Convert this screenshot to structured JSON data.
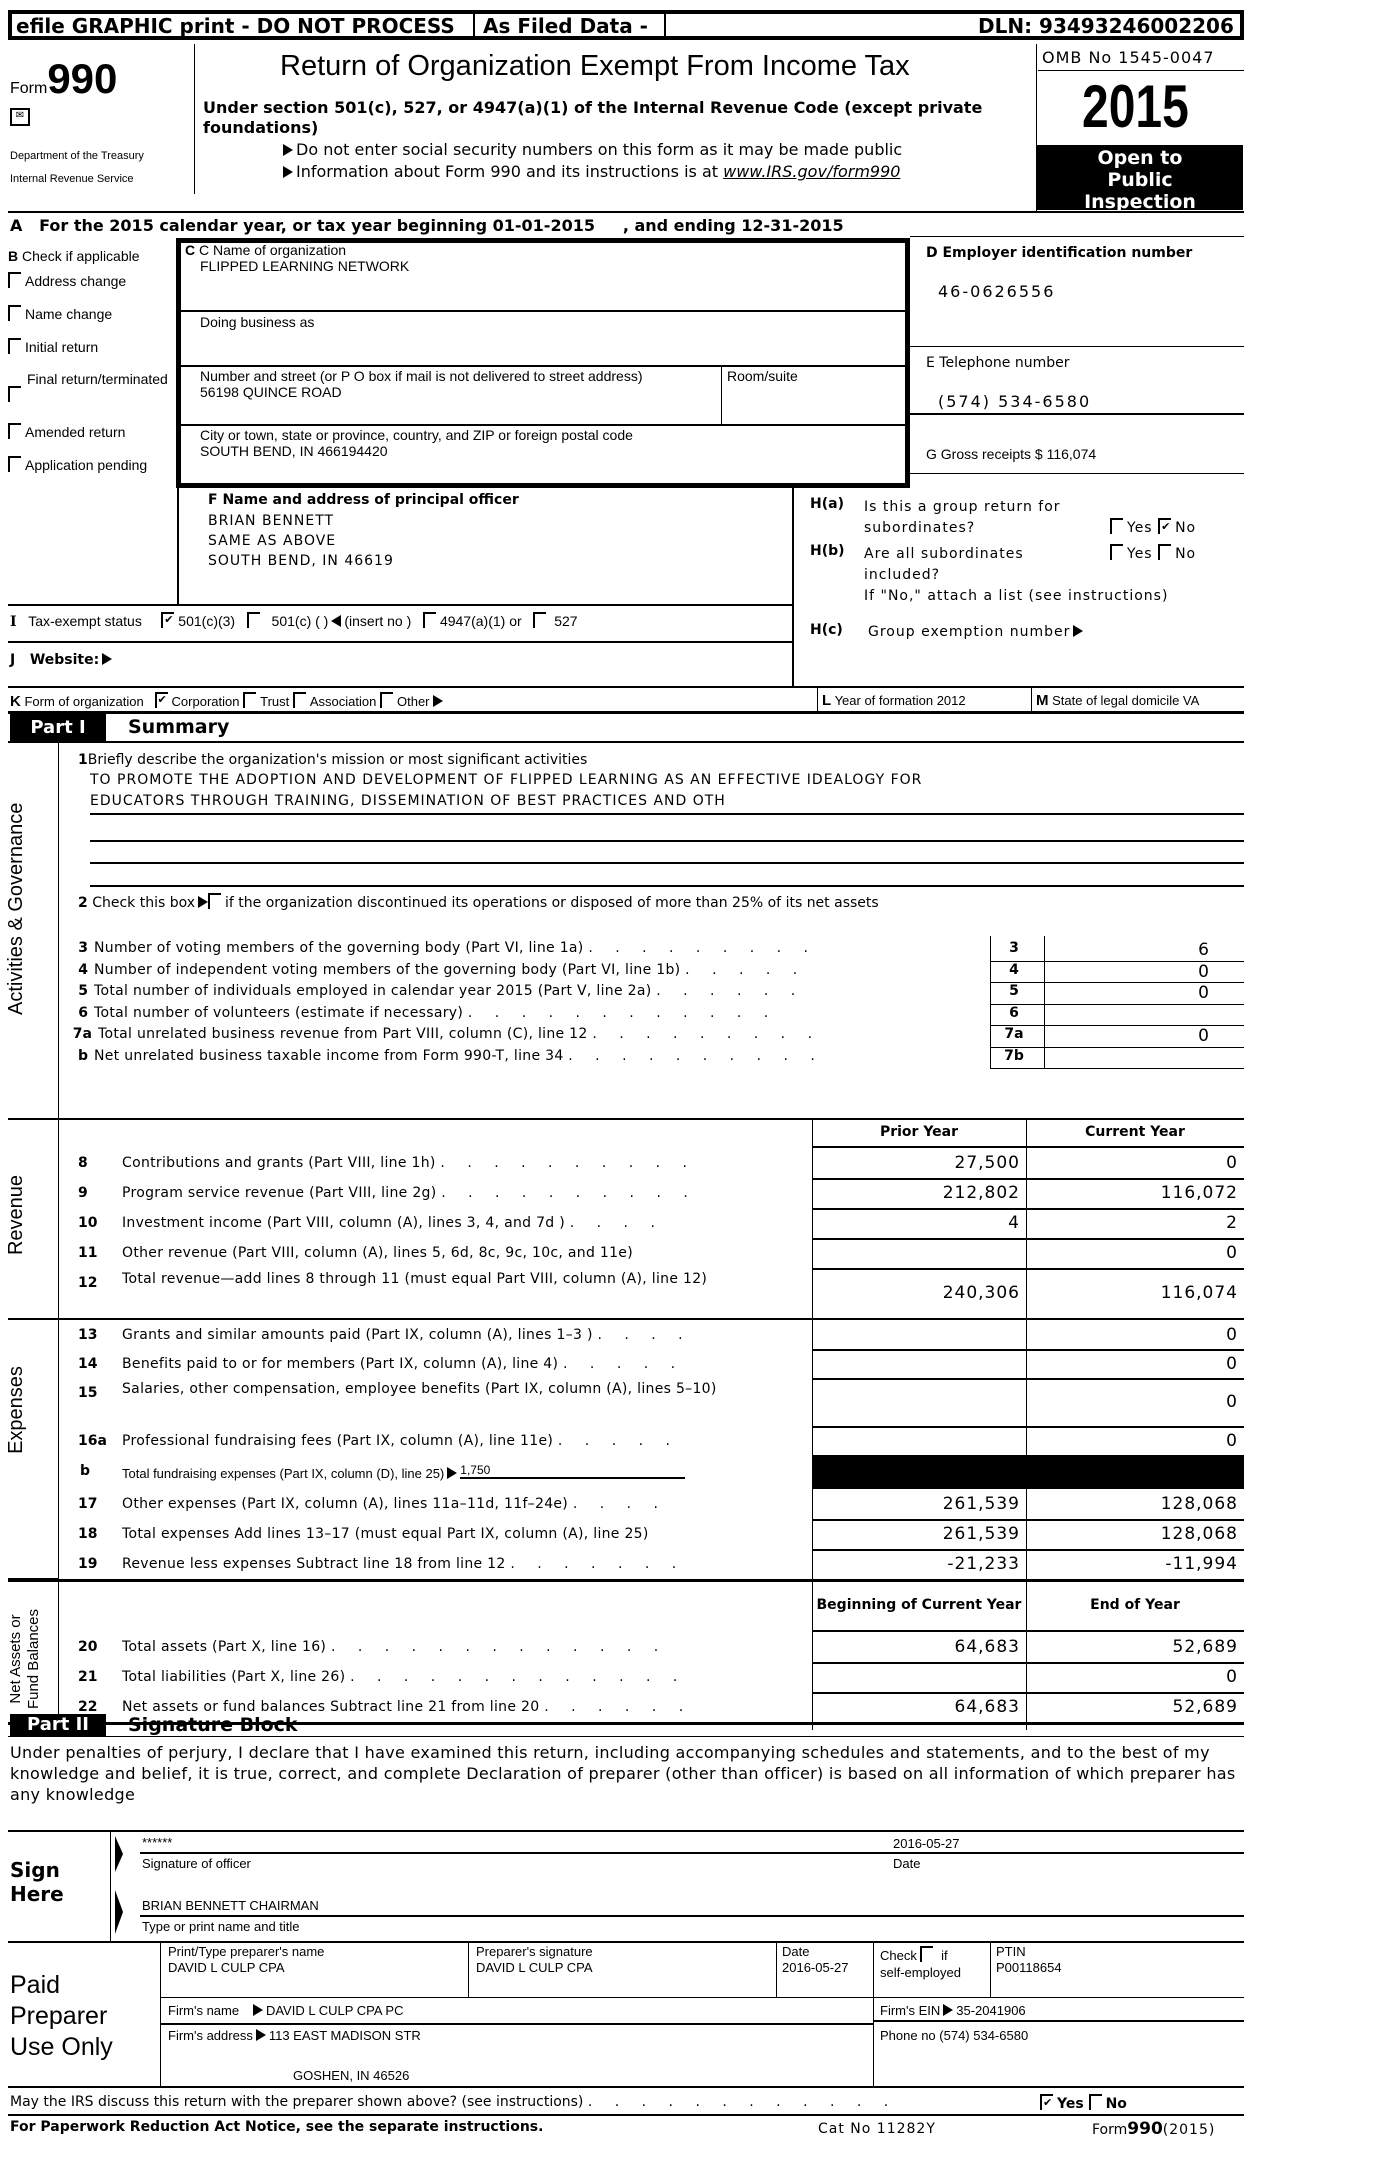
{
  "header": {
    "efile_label": "efile GRAPHIC print - DO NOT PROCESS",
    "as_filed": "As Filed Data -",
    "dln": "DLN: 93493246002206",
    "form_prefix": "Form",
    "form_number": "990",
    "dept1": "Department of the Treasury",
    "dept2": "Internal Revenue Service",
    "title": "Return of Organization Exempt From Income Tax",
    "subtitle": "Under section 501(c), 527, or 4947(a)(1) of the Internal Revenue Code (except private foundations)",
    "note1": "Do not enter social security numbers on this form as it may be made public",
    "note2_prefix": "Information about Form 990 and its instructions is at ",
    "note2_link": "www.IRS.gov/form990",
    "omb": "OMB No 1545-0047",
    "year": "2015",
    "open_public": "Open to Public Inspection"
  },
  "line_a": "A   For the 2015 calendar year, or tax year beginning 01-01-2015     , and ending 12-31-2015",
  "section_b": {
    "title": "B  Check if applicable",
    "items": [
      {
        "label": "Address change",
        "checked": false
      },
      {
        "label": "Name change",
        "checked": false
      },
      {
        "label": "Initial return",
        "checked": false
      },
      {
        "label": "Final return/terminated",
        "checked": false
      },
      {
        "label": "Amended return",
        "checked": false
      },
      {
        "label": "Application pending",
        "checked": false
      }
    ]
  },
  "section_c": {
    "name_label": "C Name of organization",
    "name_value": "FLIPPED LEARNING NETWORK",
    "dba_label": "Doing business as",
    "street_label": "Number and street (or P O  box if mail is not delivered to street address)",
    "street_value": "56198 QUINCE ROAD",
    "room_label": "Room/suite",
    "city_label": "City or town, state or province, country, and ZIP or foreign postal code",
    "city_value": "SOUTH BEND, IN  466194420"
  },
  "section_d": {
    "label": "D Employer identification number",
    "value": "46-0626556"
  },
  "section_e": {
    "label": "E Telephone number",
    "value": "(574) 534-6580"
  },
  "section_g": {
    "label": "G Gross receipts $ 116,074"
  },
  "section_f": {
    "label": "F   Name and address of principal officer",
    "lines": [
      "BRIAN BENNETT",
      "SAME AS ABOVE",
      "SOUTH BEND, IN  46619"
    ]
  },
  "section_h": {
    "ha_tag": "H(a)",
    "ha_q1": "Is this a group return for",
    "ha_q2": "subordinates?",
    "hb_tag": "H(b)",
    "hb_q1": "Are all subordinates",
    "hb_q2": "included?",
    "hb_note": "If \"No,\" attach a list  (see instructions)",
    "hc_tag": "H(c)",
    "hc_label": "Group exemption number",
    "yes": "Yes",
    "no": "No"
  },
  "section_i": {
    "tag": "I",
    "label": "Tax-exempt status",
    "opt1": "501(c)(3)",
    "opt2": "501(c) (  )",
    "insert": "(insert no )",
    "opt3": "4947(a)(1) or",
    "opt4": "527"
  },
  "section_j": {
    "label": "J   Website:"
  },
  "section_k": {
    "tag": "K",
    "label": "Form of organization",
    "opt1": "Corporation",
    "opt2": "Trust",
    "opt3": "Association",
    "opt4": "Other"
  },
  "section_l": {
    "tag": "L",
    "label": "Year of formation  2012"
  },
  "section_m": {
    "tag": "M",
    "label": "State of legal domicile  VA"
  },
  "part1": {
    "tag": "Part I",
    "title": "Summary",
    "side_activities": "Activities & Governance",
    "side_revenue": "Revenue",
    "side_expenses": "Expenses",
    "side_net1": "Net Assets or",
    "side_net2": "Fund Balances",
    "line1_label": "Briefly describe the organization's mission or most significant activities",
    "mission1": "TO PROMOTE THE ADOPTION AND DEVELOPMENT OF FLIPPED LEARNING AS AN EFFECTIVE IDEALOGY FOR",
    "mission2": "EDUCATORS THROUGH TRAINING, DISSEMINATION OF BEST PRACTICES AND OTH",
    "line2_a": "Check this box",
    "line2_b": "if the organization discontinued its operations or disposed of more than 25% of its net assets",
    "gov_lines": [
      {
        "num": "3",
        "label": "Number of voting members of the governing body (Part VI, line 1a)",
        "dots": ". . . . . . . . .",
        "box": "3",
        "value": "6"
      },
      {
        "num": "4",
        "label": "Number of independent voting members of the governing body (Part VI, line 1b)",
        "dots": ". . . . .",
        "box": "4",
        "value": "0"
      },
      {
        "num": "5",
        "label": "Total number of individuals employed in calendar year 2015 (Part V, line 2a)",
        "dots": ". . . . . .",
        "box": "5",
        "value": "0"
      },
      {
        "num": "6",
        "label": "Total number of volunteers (estimate if necessary)",
        "dots": ". . . . . . . . . . . .",
        "box": "6",
        "value": ""
      },
      {
        "num": "7a",
        "label": "Total unrelated business revenue from Part VIII, column (C), line 12",
        "dots": ". . . . . . . . .",
        "box": "7a",
        "value": "0"
      },
      {
        "num": "b",
        "label": "Net unrelated business taxable income from Form 990-T, line 34",
        "dots": ". . . . . . . . . .",
        "box": "7b",
        "value": ""
      }
    ],
    "col_prior": "Prior Year",
    "col_current": "Current Year",
    "revenue_lines": [
      {
        "num": "8",
        "label": "Contributions and grants (Part VIII, line 1h)",
        "dots": ". . . . . . . . . .",
        "prior": "27,500",
        "current": "0"
      },
      {
        "num": "9",
        "label": "Program service revenue (Part VIII, line 2g)",
        "dots": ". . . . . . . . . .",
        "prior": "212,802",
        "current": "116,072"
      },
      {
        "num": "10",
        "label": "Investment income (Part VIII, column (A), lines 3, 4, and 7d )",
        "dots": ". . . .",
        "prior": "4",
        "current": "2"
      },
      {
        "num": "11",
        "label": "Other revenue (Part VIII, column (A), lines 5, 6d, 8c, 9c, 10c, and 11e)",
        "dots": "",
        "prior": "",
        "current": "0"
      },
      {
        "num": "12",
        "label": "Total revenue—add lines 8 through 11 (must equal Part VIII, column (A), line 12)",
        "dots": "",
        "prior": "240,306",
        "current": "116,074"
      }
    ],
    "expense_lines": [
      {
        "num": "13",
        "label": "Grants and similar amounts paid (Part IX, column (A), lines 1–3 )",
        "dots": ". . . .",
        "prior": "",
        "current": "0"
      },
      {
        "num": "14",
        "label": "Benefits paid to or for members (Part IX, column (A), line 4)",
        "dots": ". . . . .",
        "prior": "",
        "current": "0"
      },
      {
        "num": "15",
        "label": "Salaries, other compensation, employee benefits (Part IX, column (A), lines 5–10)",
        "dots": "",
        "prior": "",
        "current": "0"
      },
      {
        "num": "16a",
        "label": "Professional fundraising fees (Part IX, column (A), line 11e)",
        "dots": ". . . . .",
        "prior": "",
        "current": "0"
      }
    ],
    "line16b": {
      "num": "b",
      "label": "Total fundraising expenses (Part IX, column (D), line 25)",
      "value": "1,750"
    },
    "expense_lines2": [
      {
        "num": "17",
        "label": "Other expenses (Part IX, column (A), lines 11a–11d, 11f–24e)",
        "dots": ". . . .",
        "prior": "261,539",
        "current": "128,068"
      },
      {
        "num": "18",
        "label": "Total expenses  Add lines 13–17 (must equal Part IX, column (A), line 25)",
        "dots": "",
        "prior": "261,539",
        "current": "128,068"
      },
      {
        "num": "19",
        "label": "Revenue less expenses  Subtract line 18 from line 12",
        "dots": ". . . . . . .",
        "prior": "-21,233",
        "current": "-11,994"
      }
    ],
    "col_begin": "Beginning of Current Year",
    "col_end": "End of Year",
    "net_lines": [
      {
        "num": "20",
        "label": "Total assets (Part X, line 16)",
        "dots": ". . . . . . . . . . . . .",
        "begin": "64,683",
        "end": "52,689"
      },
      {
        "num": "21",
        "label": "Total liabilities (Part X, line 26)",
        "dots": ". . . . . . . . . . . . .",
        "begin": "",
        "end": "0"
      },
      {
        "num": "22",
        "label": "Net assets or fund balances  Subtract line 21 from line 20",
        "dots": ". . . . . .",
        "begin": "64,683",
        "end": "52,689"
      }
    ]
  },
  "part2": {
    "tag": "Part II",
    "title": "Signature Block",
    "declaration": "Under penalties of perjury, I declare that I have examined this return, including accompanying schedules and statements, and to the best of my knowledge and belief, it is true, correct, and complete  Declaration of preparer (other than officer) is based on all information of which preparer has any knowledge",
    "sign_here": "Sign Here",
    "signature_value": "******",
    "signature_label": "Signature of officer",
    "date_value": "2016-05-27",
    "date_label": "Date",
    "name_title_value": "BRIAN BENNETT  CHAIRMAN",
    "name_title_label": "Type or print name and title"
  },
  "preparer": {
    "section_label": "Paid Preparer Use Only",
    "name_label": "Print/Type preparer's name",
    "name_value": "DAVID L CULP CPA",
    "sig_label": "Preparer's signature",
    "sig_value": "DAVID L CULP CPA",
    "date_label": "Date",
    "date_value": "2016-05-27",
    "check_label1": "Check",
    "check_label2": "if",
    "check_label3": "self-employed",
    "ptin_label": "PTIN",
    "ptin_value": "P00118654",
    "firm_name_label": "Firm's name",
    "firm_name_value": "DAVID L CULP CPA PC",
    "firm_ein_label": "Firm's EIN",
    "firm_ein_value": "35-2041906",
    "firm_addr_label": "Firm's address",
    "firm_addr_value1": "113 EAST MADISON STR",
    "firm_addr_value2": "GOSHEN, IN  46526",
    "phone_label": "Phone no  (574) 534-6580"
  },
  "discuss": {
    "label": "May the IRS discuss this return with the preparer shown above? (see instructions)",
    "dots": ". . . . . . . . . . . .",
    "yes": "Yes",
    "no": "No",
    "yes_checked": true
  },
  "footer": {
    "paperwork": "For Paperwork Reduction Act Notice, see the separate instructions.",
    "cat": "Cat No 11282Y",
    "form_prefix": "Form",
    "form_number": "990",
    "form_year": "(2015)"
  }
}
